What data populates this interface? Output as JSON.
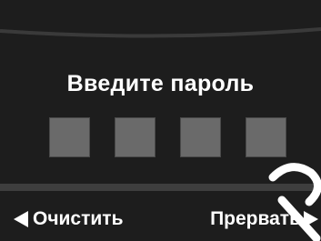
{
  "screen": {
    "prompt": "Введите пароль",
    "pin_slots": 4,
    "pin_entered": 0
  },
  "softkeys": {
    "left_label": "Очистить",
    "left_icon": "triangle-left-icon",
    "right_label": "Прервать",
    "right_icon": "triangle-right-icon"
  },
  "colors": {
    "background": "#1d1d1d",
    "text": "#ffffff",
    "pin_box": "#6a6a6a",
    "band": "#3e3e3e"
  }
}
